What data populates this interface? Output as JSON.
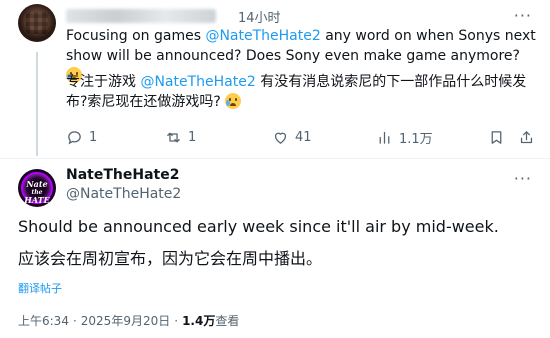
{
  "reply": {
    "time": "14小时",
    "text_en_1": "Focusing on games ",
    "mention": "@NateTheHate2",
    "text_en_2": " any word on when Sonys next show will be announced? Does Sony even make game anymore? ",
    "text_zh_1": "专注于游戏 ",
    "text_zh_2": " 有没有消息说索尼的下一部作品什么时候发布?索尼现在还做游戏吗? ",
    "emoji": "crying-face",
    "more": "···",
    "actions": {
      "reply_count": "1",
      "retweet_count": "1",
      "like_count": "41",
      "view_count": "1.1万"
    }
  },
  "main": {
    "display_name": "NateTheHate2",
    "handle": "@NateTheHate2",
    "avatar_line1": "Nate",
    "avatar_line2": "the",
    "avatar_line3": "HATE",
    "more": "···",
    "text_en": "Should be announced early week since it'll air by mid-week.",
    "text_zh": "应该会在周初宣布，因为它会在周中播出。",
    "translate_label": "翻译帖子",
    "meta_time": "上午6:34",
    "meta_sep1": "·",
    "meta_date": "2025年9月20日",
    "meta_sep2": "·",
    "meta_views": "1.4万",
    "meta_views_label": " 查看"
  },
  "colors": {
    "accent": "#1d9bf0",
    "secondary_text": "#536471",
    "primary_text": "#0f1419",
    "divider": "#eff3f4"
  }
}
